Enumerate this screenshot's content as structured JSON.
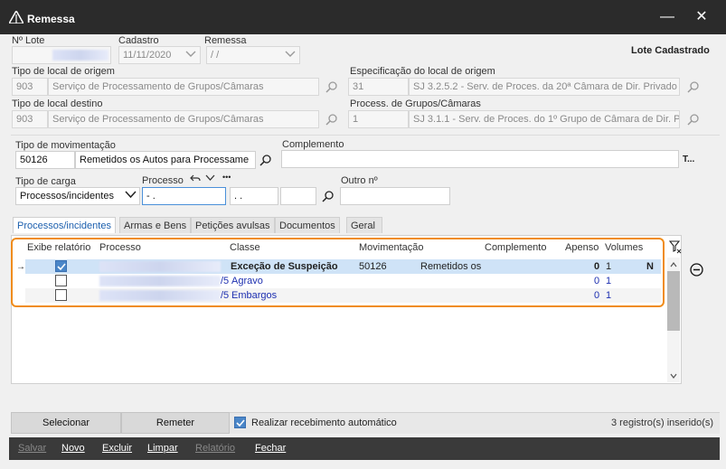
{
  "window": {
    "title": "Remessa",
    "close_glyph": "✕",
    "minimize_glyph": "—"
  },
  "header": {
    "lote_label": "Nº Lote",
    "lote_value": "",
    "cadastro_label": "Cadastro",
    "cadastro_value": "11/11/2020",
    "remessa_label": "Remessa",
    "remessa_value": " /  /",
    "status": "Lote Cadastrado"
  },
  "origem": {
    "tipo_label": "Tipo de local de origem",
    "tipo_code": "903",
    "tipo_desc": "Serviço de Processamento de Grupos/Câmaras",
    "espec_label": "Especificação do local de origem",
    "espec_code": "31",
    "espec_desc": "SJ 3.2.5.2 - Serv. de Proces. da 20ª Câmara de Dir. Privado"
  },
  "destino": {
    "tipo_label": "Tipo de local destino",
    "tipo_code": "903",
    "tipo_desc": "Serviço de Processamento de Grupos/Câmaras",
    "proc_label": "Process. de Grupos/Câmaras",
    "proc_code": "1",
    "proc_desc": "SJ 3.1.1 - Serv. de Proces. do 1º Grupo de Câmara de Dir. Pr"
  },
  "movimentacao": {
    "tipo_label": "Tipo de movimentação",
    "tipo_code": "50126",
    "tipo_desc": "Remetidos os Autos para Processame",
    "complemento_label": "Complemento",
    "complemento_value": "",
    "t_button": "T...",
    "carga_label": "Tipo de carga",
    "carga_value": "Processos/incidentes",
    "processo_label": "Processo",
    "processo_value": "   -  .",
    "processo_value2": " .  .",
    "outro_label": "Outro nº",
    "outro_value": "",
    "more": "•••"
  },
  "tabs": [
    {
      "label": "Processos/incidentes"
    },
    {
      "label": "Armas e Bens"
    },
    {
      "label": "Petições avulsas"
    },
    {
      "label": "Documentos"
    },
    {
      "label": "Geral"
    }
  ],
  "grid": {
    "columns": [
      "Exibe relatório",
      "Processo",
      "Classe",
      "Movimentação",
      "Complemento",
      "Apenso",
      "Volumes"
    ],
    "rows": [
      {
        "checked": true,
        "processo_suffix": "",
        "classe": "Exceção de Suspeição",
        "movimentacao": "50126",
        "complemento": "Remetidos os",
        "apenso": "0",
        "volumes": "1",
        "extra": "N"
      },
      {
        "checked": false,
        "processo_suffix": "/5",
        "classe": "Agravo",
        "movimentacao": "",
        "complemento": "",
        "apenso": "0",
        "volumes": "1",
        "extra": ""
      },
      {
        "checked": false,
        "processo_suffix": "/5",
        "classe": "Embargos",
        "movimentacao": "",
        "complemento": "",
        "apenso": "0",
        "volumes": "1",
        "extra": ""
      }
    ]
  },
  "actions": {
    "selecionar": "Selecionar",
    "remeter": "Remeter",
    "auto_receive_label": "Realizar recebimento automático",
    "auto_receive_checked": true,
    "count": "3 registro(s) inserido(s)"
  },
  "footer": {
    "salvar": "Salvar",
    "novo": "Novo",
    "excluir": "Excluir",
    "limpar": "Limpar",
    "relatorio": "Relatório",
    "fechar": "Fechar"
  },
  "colors": {
    "accent": "#1c5fae",
    "highlight": "#f08c1a",
    "titlebar": "#2b2b2b",
    "footer": "#3a3a3a"
  }
}
